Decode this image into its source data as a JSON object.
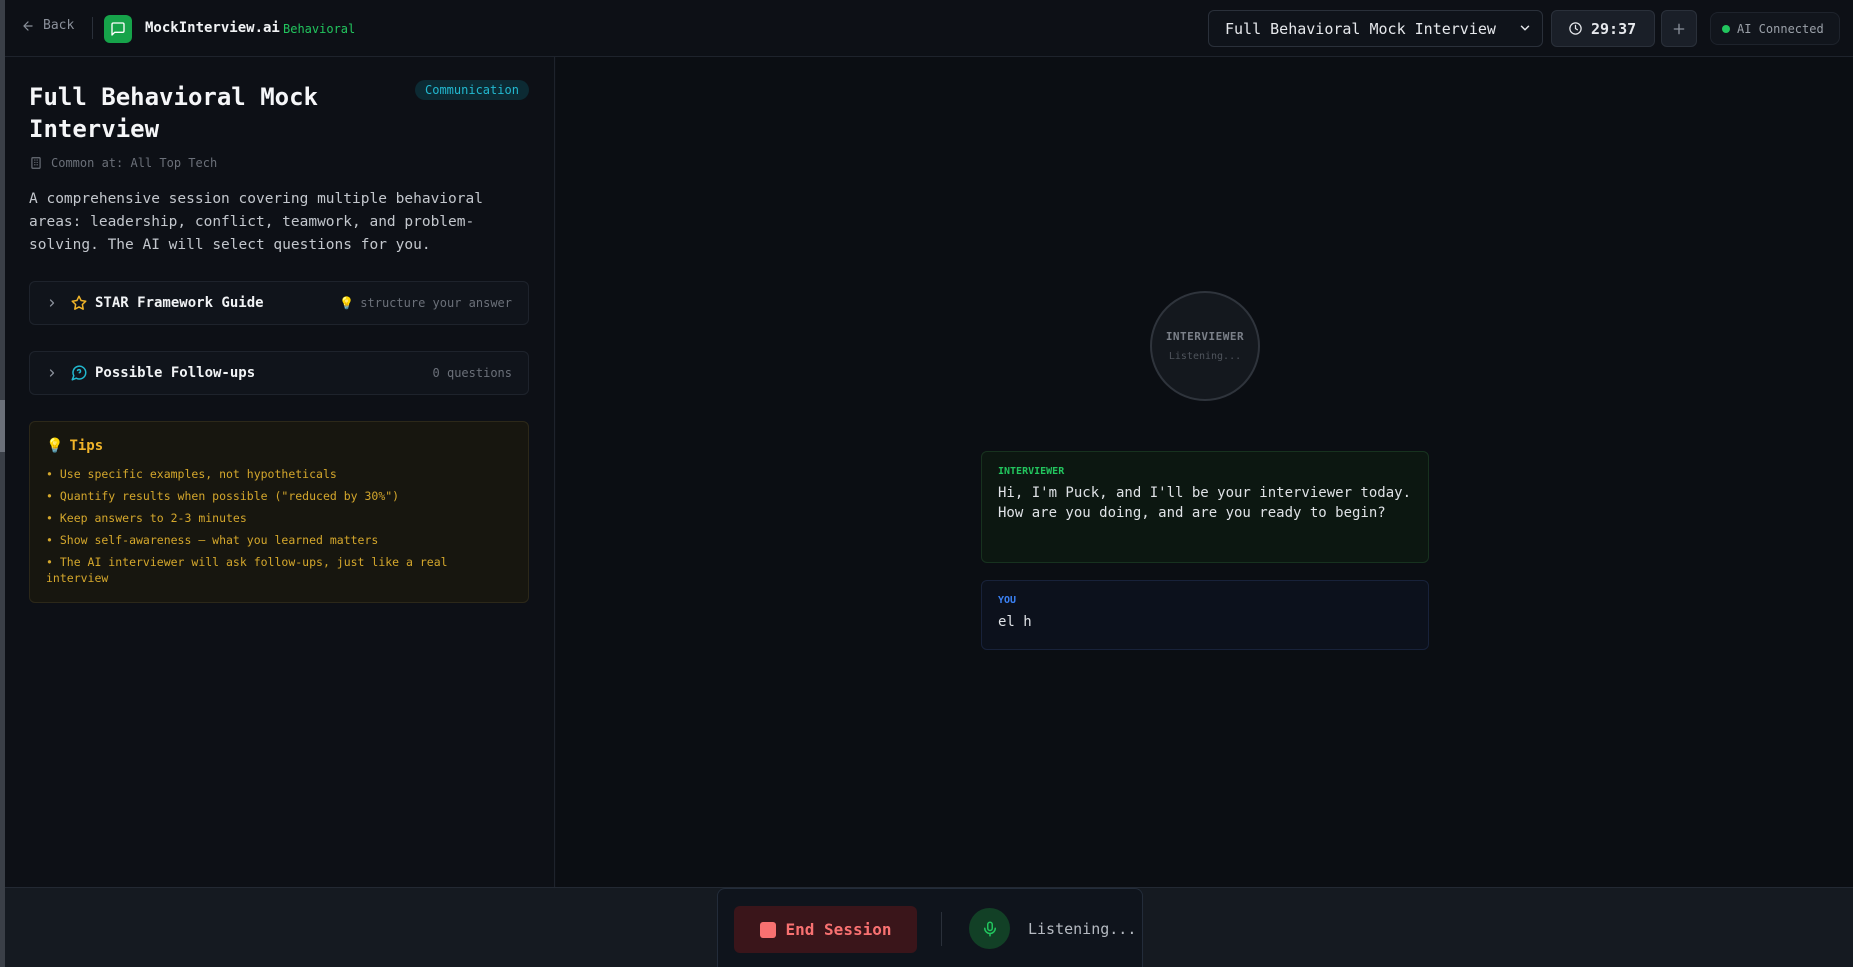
{
  "header": {
    "back_label": "Back",
    "brand": "MockInterview.ai",
    "brand_tag": "Behavioral",
    "session_select": "Full Behavioral Mock Interview",
    "timer": "29:37",
    "ai_status": "AI Connected"
  },
  "question": {
    "title": "Full Behavioral Mock Interview",
    "category": "Communication",
    "common_at": "Common at: All Top Tech",
    "description": "A comprehensive session covering multiple behavioral areas: leadership, conflict, teamwork, and problem-solving. The AI will select questions for you."
  },
  "star_guide": {
    "label": "STAR Framework Guide",
    "hint": "structure your answer"
  },
  "followups": {
    "label": "Possible Follow-ups",
    "count": "0 questions"
  },
  "tips": {
    "title": "Tips",
    "items": [
      "• Use specific examples, not hypotheticals",
      "• Quantify results when possible (\"reduced by 30%\")",
      "• Keep answers to 2-3 minutes",
      "• Show self-awareness — what you learned matters",
      "• The AI interviewer will ask follow-ups, just like a real interview"
    ]
  },
  "avatar": {
    "label": "INTERVIEWER",
    "status": "Listening..."
  },
  "transcript": [
    {
      "speaker": "INTERVIEWER",
      "text": "Hi, I'm Puck, and I'll be your interviewer today. How are you doing, and are you ready to begin?"
    },
    {
      "speaker": "YOU",
      "text": "el h"
    }
  ],
  "controls": {
    "end_label": "End Session",
    "listening": "Listening..."
  },
  "colors": {
    "accent_green": "#22c55e",
    "accent_blue": "#3b82f6",
    "danger": "#f87171",
    "tips_yellow": "#d4a72c",
    "badge_cyan": "#22b8cf"
  },
  "icons": {
    "back": "arrow-left-icon",
    "logo": "chat-bubble-icon",
    "timer": "clock-icon",
    "add": "plus-icon",
    "star": "star-icon",
    "followups": "message-circle-icon",
    "building": "building-icon",
    "tips": "lightbulb-icon",
    "mic": "microphone-icon",
    "stop": "stop-icon"
  }
}
